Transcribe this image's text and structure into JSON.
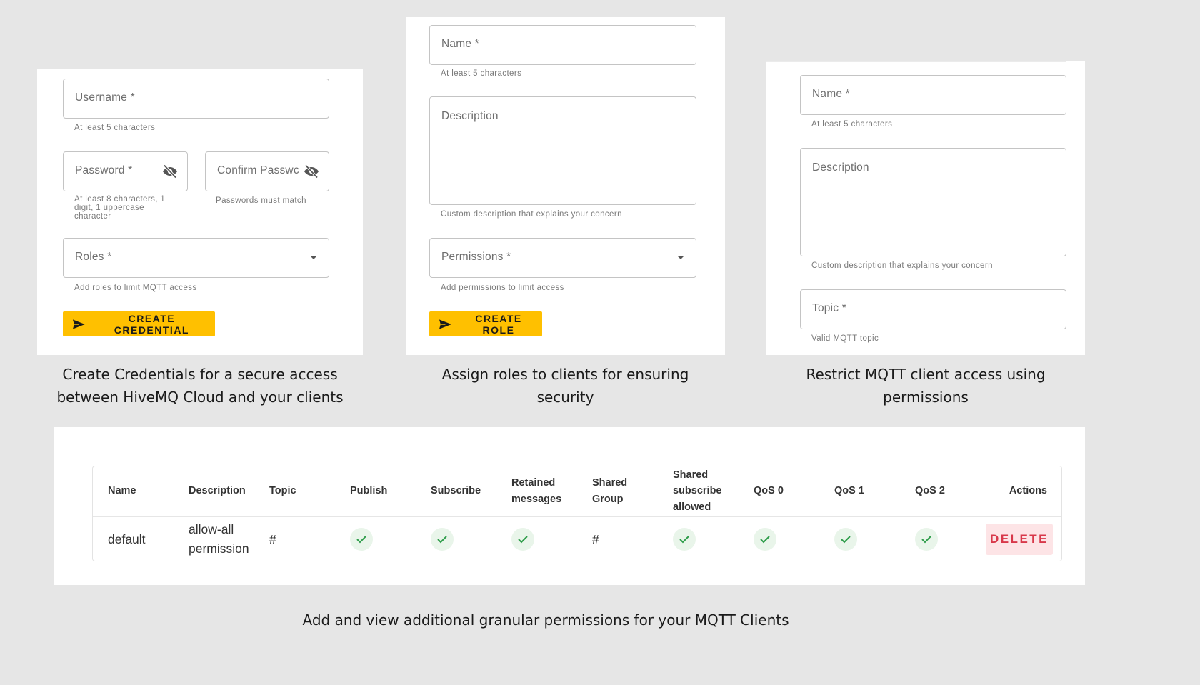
{
  "credential_form": {
    "username": {
      "placeholder": "Username *",
      "helper": "At least 5 characters"
    },
    "password": {
      "placeholder": "Password *",
      "helper_lines": [
        "At least 8 characters, 1",
        "digit, 1 uppercase",
        "character"
      ],
      "icon": "visibility-off-icon"
    },
    "confirm_password": {
      "placeholder": "Confirm Passwc",
      "helper": "Passwords must match",
      "icon": "visibility-off-icon"
    },
    "roles": {
      "placeholder": "Roles *",
      "helper": "Add roles to limit MQTT access"
    },
    "submit_label": "CREATE CREDENTIAL",
    "caption_lines": [
      "Create Credentials for a secure access",
      "between HiveMQ Cloud and your clients"
    ]
  },
  "role_form": {
    "name": {
      "placeholder": "Name *",
      "helper": "At least 5 characters"
    },
    "description": {
      "placeholder": "Description",
      "helper": "Custom description that explains your concern"
    },
    "permissions": {
      "placeholder": "Permissions *",
      "helper": "Add permissions to limit access"
    },
    "submit_label": "CREATE ROLE",
    "caption_lines": [
      "Assign roles to clients for ensuring",
      "security"
    ]
  },
  "permission_form": {
    "name": {
      "placeholder": "Name *",
      "helper": "At least 5 characters"
    },
    "description": {
      "placeholder": "Description",
      "helper": "Custom description that explains your concern"
    },
    "topic": {
      "placeholder": "Topic *",
      "helper": "Valid MQTT topic"
    },
    "caption_lines": [
      "Restrict MQTT client access using",
      "permissions"
    ]
  },
  "permissions_table": {
    "headers": [
      [
        "Name"
      ],
      [
        "Description"
      ],
      [
        "Topic"
      ],
      [
        "Publish"
      ],
      [
        "Subscribe"
      ],
      [
        "Retained",
        "messages"
      ],
      [
        "Shared",
        "Group"
      ],
      [
        "Shared",
        "subscribe",
        "allowed"
      ],
      [
        "QoS 0"
      ],
      [
        "QoS 1"
      ],
      [
        "QoS 2"
      ],
      [
        "Actions"
      ]
    ],
    "rows": [
      {
        "name": "default",
        "description_lines": [
          "allow-all",
          "permission"
        ],
        "topic": "#",
        "publish": true,
        "subscribe": true,
        "retained_messages": true,
        "shared_group": "#",
        "shared_subscribe_allowed": true,
        "qos0": true,
        "qos1": true,
        "qos2": true,
        "action_label": "DELETE"
      }
    ],
    "caption": "Add and view additional granular permissions for your MQTT Clients"
  },
  "colors": {
    "accent": "#ffc000",
    "check": "#2e9d4a",
    "check_bg": "#e9f5ea",
    "danger": "#d8384a",
    "danger_bg": "#fde4e6",
    "page_bg": "#e6e6e6"
  }
}
